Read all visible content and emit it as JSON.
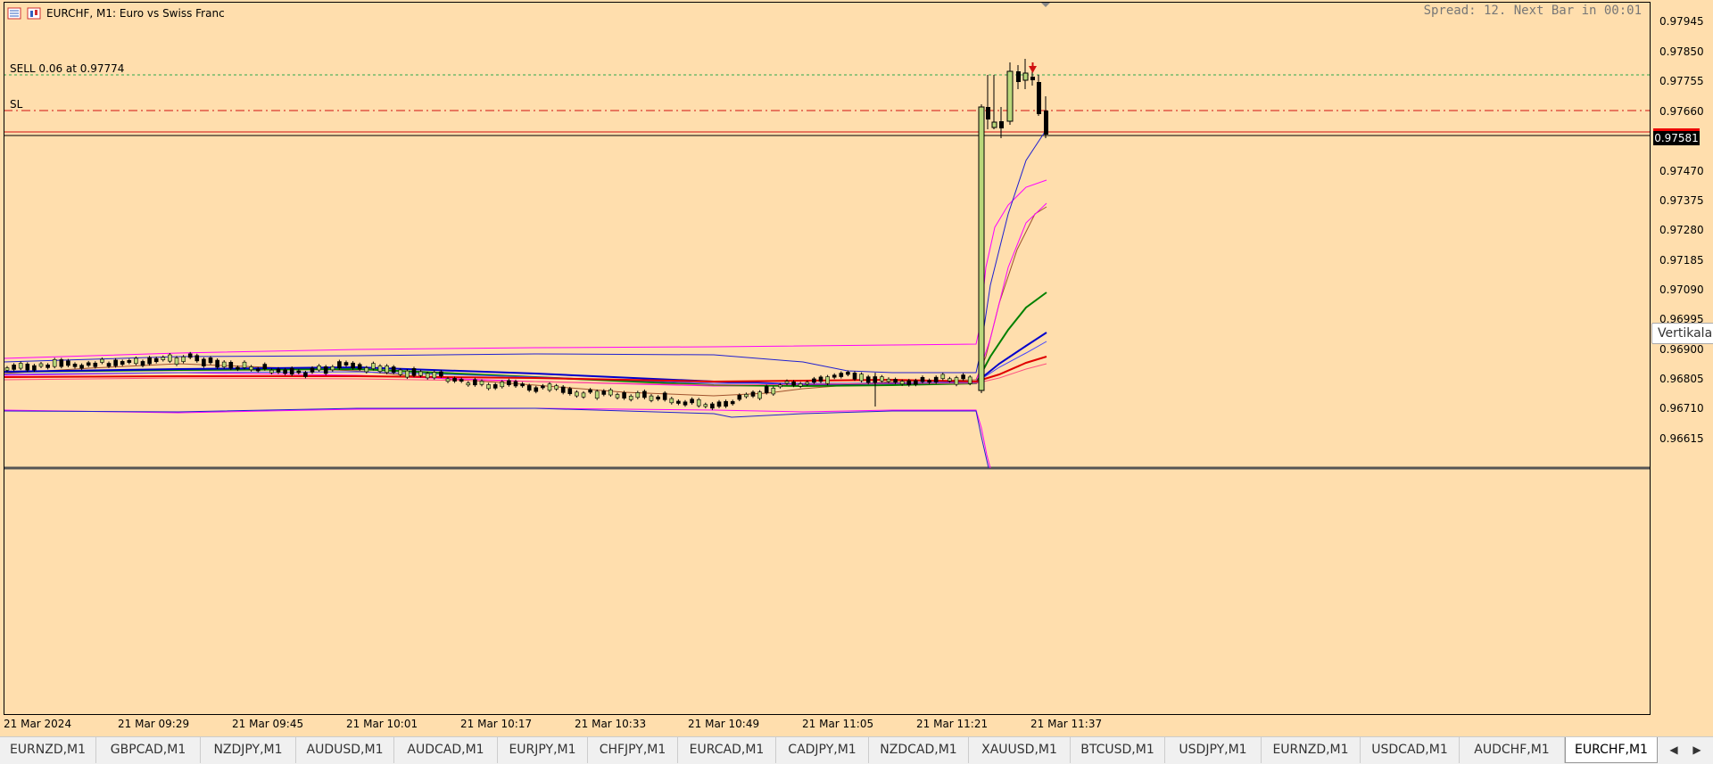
{
  "header": {
    "symbol_text": "EURCHF, M1:  Euro vs Swiss Franc",
    "spread_text": "Spread: 12. Next Bar in 00:01",
    "icons": [
      "one-click-trading-icon",
      "chart-type-icon"
    ]
  },
  "orders": {
    "sell_label": "SELL 0.06 at 0.97774",
    "sl_label": "SL"
  },
  "price_axis": {
    "ticks": [
      "0.97945",
      "0.97850",
      "0.97755",
      "0.97660",
      "0.97470",
      "0.97375",
      "0.97280",
      "0.97185",
      "0.97090",
      "0.96995",
      "0.96900",
      "0.96805",
      "0.96710",
      "0.96615"
    ],
    "current_price": "0.97581"
  },
  "time_axis": {
    "ticks": [
      "21 Mar 2024",
      "21 Mar 09:29",
      "21 Mar 09:45",
      "21 Mar 10:01",
      "21 Mar 10:17",
      "21 Mar 10:33",
      "21 Mar 10:49",
      "21 Mar 11:05",
      "21 Mar 11:21",
      "21 Mar 11:37"
    ]
  },
  "tooltip": {
    "text": "Vertikala"
  },
  "tabs": {
    "items": [
      "EURNZD,M1",
      "GBPCAD,M1",
      "NZDJPY,M1",
      "AUDUSD,M1",
      "AUDCAD,M1",
      "EURJPY,M1",
      "CHFJPY,M1",
      "EURCAD,M1",
      "CADJPY,M1",
      "NZDCAD,M1",
      "XAUUSD,M1",
      "BTCUSD,M1",
      "USDJPY,M1",
      "EURNZD,M1",
      "USDCAD,M1",
      "AUDCHF,M1",
      "EURCHF,M1"
    ],
    "active_index": 16,
    "scroll_left": "◀",
    "scroll_right": "▶"
  },
  "colors": {
    "chart_background": "#ffdead",
    "bull_candle": "#b9d77a",
    "bear_candle": "#000000",
    "sell_line": "#2ea84a",
    "sl_line": "#d01010",
    "current_price_line": "#d01010",
    "ma_blue": "#0000cc",
    "ma_green": "#008000",
    "ma_red": "#e00000",
    "ma_brown": "#a0522d",
    "band_magenta": "#ff00ff",
    "band_blue": "#2020d0"
  }
}
